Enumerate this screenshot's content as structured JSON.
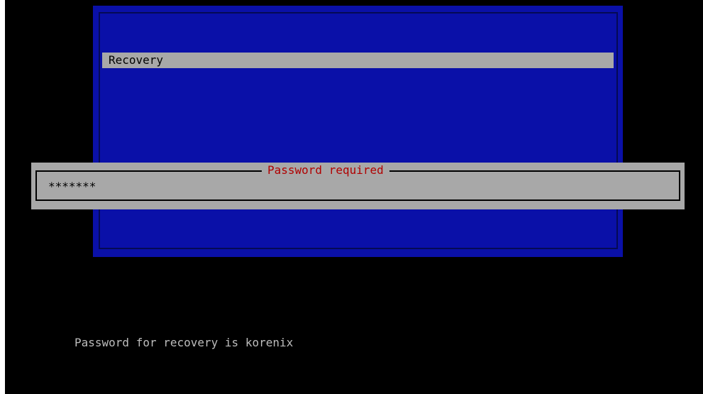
{
  "menu": {
    "items": [
      {
        "label": "Recovery",
        "selected": true
      }
    ]
  },
  "password_dialog": {
    "title": "Password required",
    "masked_value": "*******"
  },
  "hint": {
    "text": "Password for recovery is korenix"
  },
  "colors": {
    "screen_background": "#000000",
    "menu_background": "#0a10a8",
    "dialog_background": "#a8a8a8",
    "dialog_title": "#b00000",
    "hint_text": "#bdbdbd"
  }
}
